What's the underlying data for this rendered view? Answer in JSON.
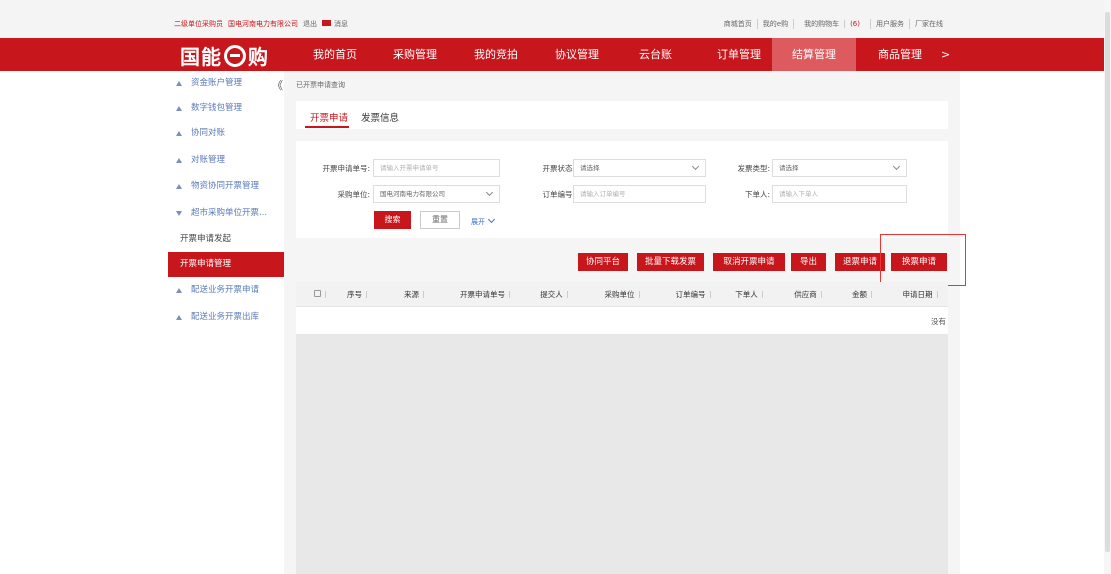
{
  "topbar": {
    "user_role": "二级单位采购员",
    "company": "国电河南电力有限公司",
    "logout": "退出",
    "messages": "消息",
    "links": [
      "商城首页",
      "我的e购",
      "我的购物车"
    ],
    "cart_count": "(6)",
    "links2": [
      "用户服务",
      "厂家在线"
    ]
  },
  "nav": {
    "logo_left": "国能",
    "logo_right": "购",
    "items": [
      "我的首页",
      "采购管理",
      "我的竞拍",
      "协议管理",
      "云台账",
      "订单管理",
      "结算管理",
      "商品管理"
    ],
    "more": ">",
    "active_index": 6
  },
  "sidebar": {
    "collapse": "《",
    "items": [
      "资金账户管理",
      "数字钱包管理",
      "协同对账",
      "对账管理",
      "物资协同开票管理",
      "超市采购单位开票...",
      "开票申请发起",
      "开票申请管理",
      "配送业务开票申请",
      "配送业务开票出库"
    ]
  },
  "breadcrumb": "已开票申请查询",
  "tabs": [
    "开票申请",
    "发票信息"
  ],
  "filter": {
    "invoice_no_label": "开票申请单号:",
    "invoice_no_placeholder": "请输入开票申请单号",
    "status_label": "开票状态:",
    "status_value": "请选择",
    "type_label": "发票类型:",
    "type_value": "请选择",
    "buyer_label": "采购单位:",
    "buyer_value": "国电河南电力有限公司",
    "order_label": "订单编号:",
    "order_placeholder": "请输入订单编号",
    "placer_label": "下单人:",
    "placer_placeholder": "请输入下单人",
    "search": "搜索",
    "reset": "重置",
    "expand": "展开"
  },
  "actions": [
    "协同平台",
    "批量下载发票",
    "取消开票申请",
    "导出",
    "退票申请",
    "换票申请"
  ],
  "table": {
    "headers": [
      "序号",
      "来源",
      "开票申请单号",
      "提交人",
      "采购单位",
      "订单编号",
      "下单人",
      "供应商",
      "金额",
      "申请日期"
    ],
    "empty": "没有"
  },
  "colors": {
    "brand": "#c8161d",
    "nav_active": "#dd5a5f"
  }
}
